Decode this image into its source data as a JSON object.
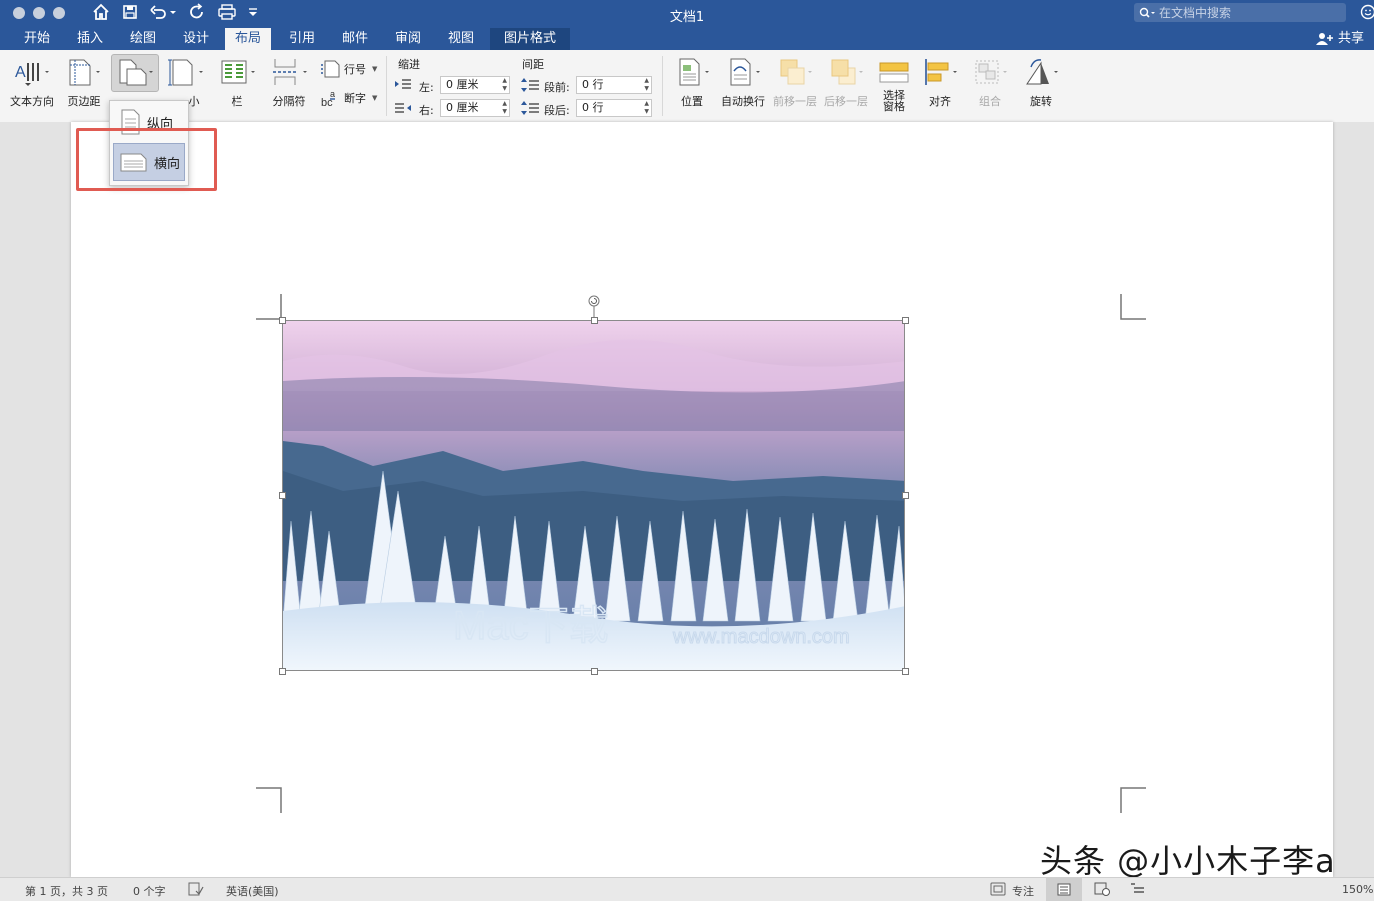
{
  "window": {
    "title": "文档1",
    "search_placeholder": "在文档中搜索",
    "share_label": "共享"
  },
  "tabs": [
    {
      "label": "开始"
    },
    {
      "label": "插入"
    },
    {
      "label": "绘图"
    },
    {
      "label": "设计"
    },
    {
      "label": "布局"
    },
    {
      "label": "引用"
    },
    {
      "label": "邮件"
    },
    {
      "label": "审阅"
    },
    {
      "label": "视图"
    },
    {
      "label": "图片格式"
    }
  ],
  "ribbon": {
    "text_direction": "文本方向",
    "margins": "页边距",
    "size": "小",
    "columns": "栏",
    "breaks": "分隔符",
    "line_numbers": "行号",
    "hyphenation": "断字",
    "indent_header": "缩进",
    "spacing_header": "间距",
    "indent_left_label": "左:",
    "indent_left_value": "0 厘米",
    "indent_right_label": "右:",
    "indent_right_value": "0 厘米",
    "spacing_before_label": "段前:",
    "spacing_before_value": "0 行",
    "spacing_after_label": "段后:",
    "spacing_after_value": "0 行",
    "position": "位置",
    "wrap_text": "自动换行",
    "bring_forward": "前移一层",
    "send_backward": "后移一层",
    "selection_pane_1": "选择",
    "selection_pane_2": "窗格",
    "align": "对齐",
    "group": "组合",
    "rotate": "旋转"
  },
  "orientation_menu": {
    "portrait": "纵向",
    "landscape": "横向"
  },
  "image": {
    "watermark_brand": "Mac下载",
    "watermark_url": "www.macdown.com"
  },
  "statusbar": {
    "page_info": "第 1 页，共 3 页",
    "word_count": "0 个字",
    "language": "英语(美国)",
    "focus": "专注",
    "zoom": "150%"
  },
  "overlay_watermark": "头条 @小小木子李a",
  "colors": {
    "title_blue": "#2b579a",
    "highlight_red": "#e05b52",
    "selected_item": "#c5cfe3"
  }
}
